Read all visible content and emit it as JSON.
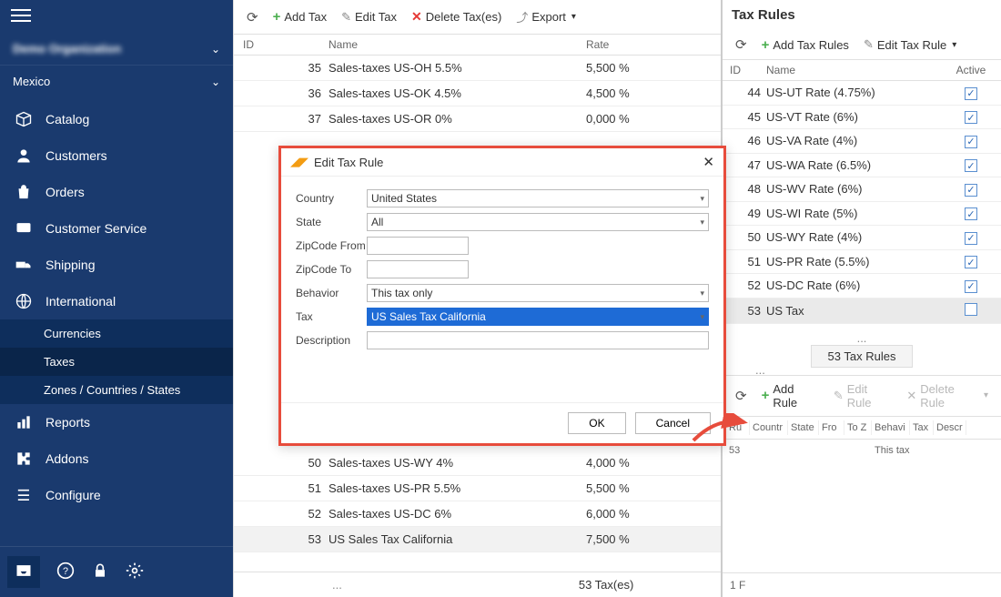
{
  "sidebar": {
    "org": "Demo Organization",
    "region": "Mexico",
    "items": [
      {
        "icon": "box",
        "label": "Catalog"
      },
      {
        "icon": "person",
        "label": "Customers"
      },
      {
        "icon": "bag",
        "label": "Orders"
      },
      {
        "icon": "chat",
        "label": "Customer Service"
      },
      {
        "icon": "truck",
        "label": "Shipping"
      },
      {
        "icon": "globe",
        "label": "International",
        "sub": [
          {
            "label": "Currencies"
          },
          {
            "label": "Taxes",
            "active": true
          },
          {
            "label": "Zones / Countries / States"
          }
        ]
      },
      {
        "icon": "chart",
        "label": "Reports"
      },
      {
        "icon": "puzzle",
        "label": "Addons"
      },
      {
        "icon": "gear",
        "label": "Configure"
      }
    ]
  },
  "main_toolbar": {
    "add": "Add Tax",
    "edit": "Edit Tax",
    "delete": "Delete Tax(es)",
    "export": "Export"
  },
  "tax_table": {
    "headers": {
      "id": "ID",
      "name": "Name",
      "rate": "Rate"
    },
    "rows": [
      {
        "id": "35",
        "name": "Sales-taxes US-OH 5.5%",
        "rate": "5,500 %"
      },
      {
        "id": "36",
        "name": "Sales-taxes US-OK 4.5%",
        "rate": "4,500 %"
      },
      {
        "id": "37",
        "name": "Sales-taxes US-OR 0%",
        "rate": "0,000 %"
      },
      {
        "id": "50",
        "name": "Sales-taxes US-WY 4%",
        "rate": "4,000 %",
        "gap": true
      },
      {
        "id": "51",
        "name": "Sales-taxes US-PR 5.5%",
        "rate": "5,500 %"
      },
      {
        "id": "52",
        "name": "Sales-taxes US-DC 6%",
        "rate": "6,000 %"
      },
      {
        "id": "53",
        "name": "US Sales Tax California",
        "rate": "7,500 %",
        "hl": true
      }
    ],
    "footer": "53 Tax(es)"
  },
  "right": {
    "title": "Tax Rules",
    "toolbar": {
      "add": "Add Tax Rules",
      "edit": "Edit Tax Rule"
    },
    "headers": {
      "id": "ID",
      "name": "Name",
      "active": "Active"
    },
    "rows": [
      {
        "id": "44",
        "name": "US-UT Rate (4.75%)",
        "checked": true
      },
      {
        "id": "45",
        "name": "US-VT Rate (6%)",
        "checked": true
      },
      {
        "id": "46",
        "name": "US-VA Rate (4%)",
        "checked": true
      },
      {
        "id": "47",
        "name": "US-WA Rate (6.5%)",
        "checked": true
      },
      {
        "id": "48",
        "name": "US-WV Rate (6%)",
        "checked": true
      },
      {
        "id": "49",
        "name": "US-WI Rate (5%)",
        "checked": true
      },
      {
        "id": "50",
        "name": "US-WY Rate (4%)",
        "checked": true
      },
      {
        "id": "51",
        "name": "US-PR Rate (5.5%)",
        "checked": true
      },
      {
        "id": "52",
        "name": "US-DC Rate (6%)",
        "checked": true
      },
      {
        "id": "53",
        "name": "US Tax",
        "checked": false,
        "sel": true
      }
    ],
    "summary": "53 Tax Rules",
    "toolbar2": {
      "add": "Add Rule",
      "edit": "Edit Rule",
      "delete": "Delete Rule"
    },
    "th2": [
      "Ru",
      "Countr",
      "State",
      "Fro",
      "To Z",
      "Behavi",
      "Tax",
      "Descr"
    ],
    "d2": {
      "id": "53",
      "beh": "This tax"
    },
    "foot": "1 F"
  },
  "modal": {
    "title": "Edit Tax Rule",
    "fields": {
      "country": {
        "label": "Country",
        "value": "United States"
      },
      "state": {
        "label": "State",
        "value": "All"
      },
      "zipfrom": {
        "label": "ZipCode From",
        "value": ""
      },
      "zipto": {
        "label": "ZipCode To",
        "value": ""
      },
      "behavior": {
        "label": "Behavior",
        "value": "This tax only"
      },
      "tax": {
        "label": "Tax",
        "value": "US Sales Tax California"
      },
      "desc": {
        "label": "Description",
        "value": ""
      }
    },
    "ok": "OK",
    "cancel": "Cancel"
  }
}
